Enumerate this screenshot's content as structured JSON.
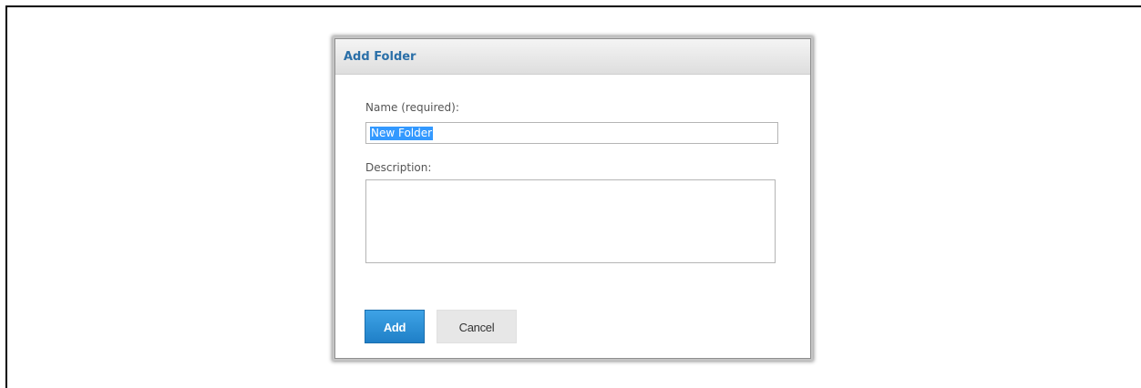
{
  "dialog": {
    "title": "Add Folder",
    "name_label": "Name (required):",
    "name_value": "New Folder",
    "description_label": "Description:",
    "description_value": "",
    "add_label": "Add",
    "cancel_label": "Cancel"
  },
  "colors": {
    "title": "#2a6fa8",
    "add_button": "#2b8ed6",
    "selection": "#3399ff",
    "cancel_button": "#e7e7e7"
  }
}
